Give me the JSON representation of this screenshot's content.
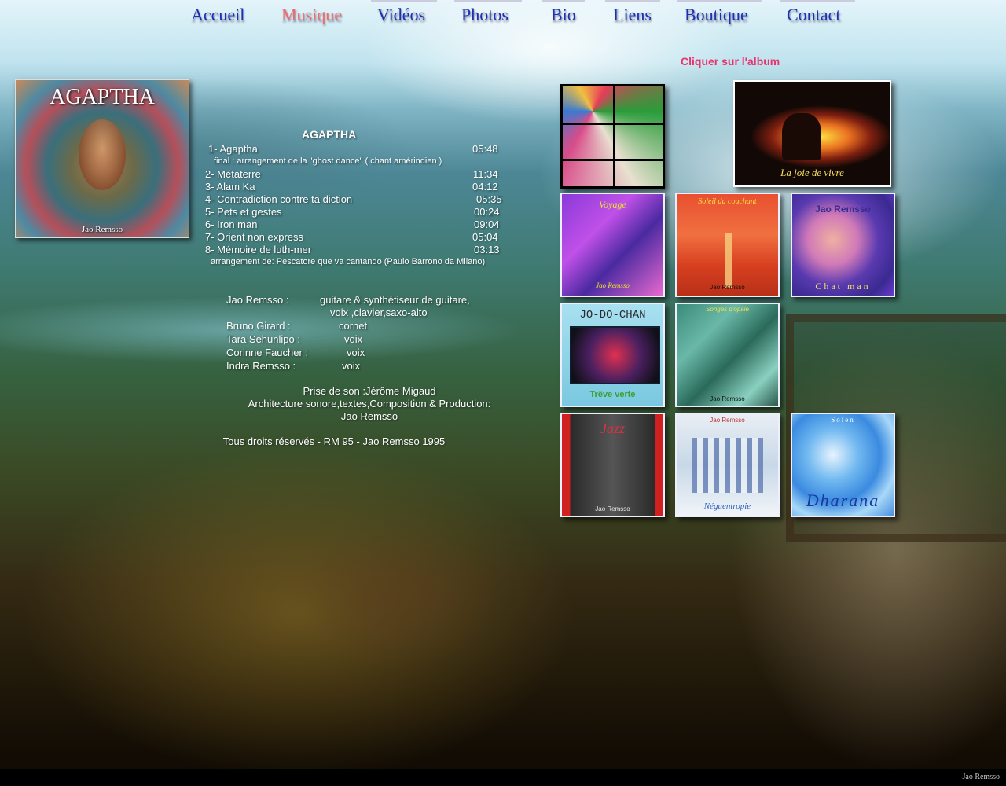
{
  "nav": {
    "items": [
      {
        "label": "Accueil"
      },
      {
        "label": "Musique"
      },
      {
        "label": "Vidéos"
      },
      {
        "label": "Photos"
      },
      {
        "label": "Bio"
      },
      {
        "label": "Liens"
      },
      {
        "label": "Boutique"
      },
      {
        "label": "Contact"
      }
    ],
    "active": "Musique"
  },
  "cover": {
    "title": "AGAPTHA",
    "artist": "Jao Remsso"
  },
  "album": {
    "heading": "AGAPTHA",
    "tracks": [
      {
        "title": "1- Agaptha",
        "duration": "05:48"
      },
      {
        "title": "2- Métaterre",
        "duration": "11:34"
      },
      {
        "title": "3- Alam Ka",
        "duration": "04:12"
      },
      {
        "title": "4- Contradiction contre ta diction",
        "duration": "05:35"
      },
      {
        "title": "5- Pets et gestes",
        "duration": "00:24"
      },
      {
        "title": "6- Iron man",
        "duration": "09:04"
      },
      {
        "title": "7- Orient non express",
        "duration": "05:04"
      },
      {
        "title": "8- Mémoire de luth-mer",
        "duration": "03:13"
      }
    ],
    "note1": "final : arrangement de la \"ghost dance\" ( chant amérindien )",
    "note8": "arrangement de: Pescatore que va cantando (Paulo Barrono da Milano)"
  },
  "credits": [
    {
      "name": "Jao Remsso :",
      "role": "guitare & synthétiseur de guitare,"
    },
    {
      "name": "",
      "role": "voix ,clavier,saxo-alto"
    },
    {
      "name": "Bruno Girard :",
      "role": "cornet"
    },
    {
      "name": "Tara Sehunlipo :",
      "role": "voix"
    },
    {
      "name": "Corinne Faucher :",
      "role": "voix"
    },
    {
      "name": "Indra Remsso :",
      "role": "voix"
    }
  ],
  "production": {
    "line1": "Prise de son :Jérôme Migaud",
    "line2": "Architecture sonore,textes,Composition & Production:",
    "line3": "Jao Remsso",
    "rights": "Tous droits réservés - RM 95 - Jao Remsso 1995"
  },
  "albums": {
    "hint": "Cliquer sur l'album",
    "covers": [
      {
        "label": ""
      },
      {
        "label": "La joie de vivre"
      },
      {
        "label": "Voyage",
        "artist": "Jao Remsso"
      },
      {
        "label": "Soleil du couchant",
        "artist": "Jao Remsso"
      },
      {
        "label": "Chat man",
        "artist": "Jao Remsso"
      },
      {
        "label": "JO-DO-CHAN",
        "sub": "Trêve verte"
      },
      {
        "label": "Songes d'opale",
        "artist": "Jao Remsso"
      },
      {
        "label": "Jazz",
        "artist": "Jao Remsso"
      },
      {
        "label": "Néguentropie",
        "artist": "Jao Remsso"
      },
      {
        "label": "Dharana",
        "artist": "Solen"
      }
    ]
  },
  "colors": {
    "nav": "#1c2fb4",
    "nav_active": "#f26a6a",
    "hint": "#e8336d"
  },
  "footer": {
    "credit": "Jao Remsso"
  }
}
